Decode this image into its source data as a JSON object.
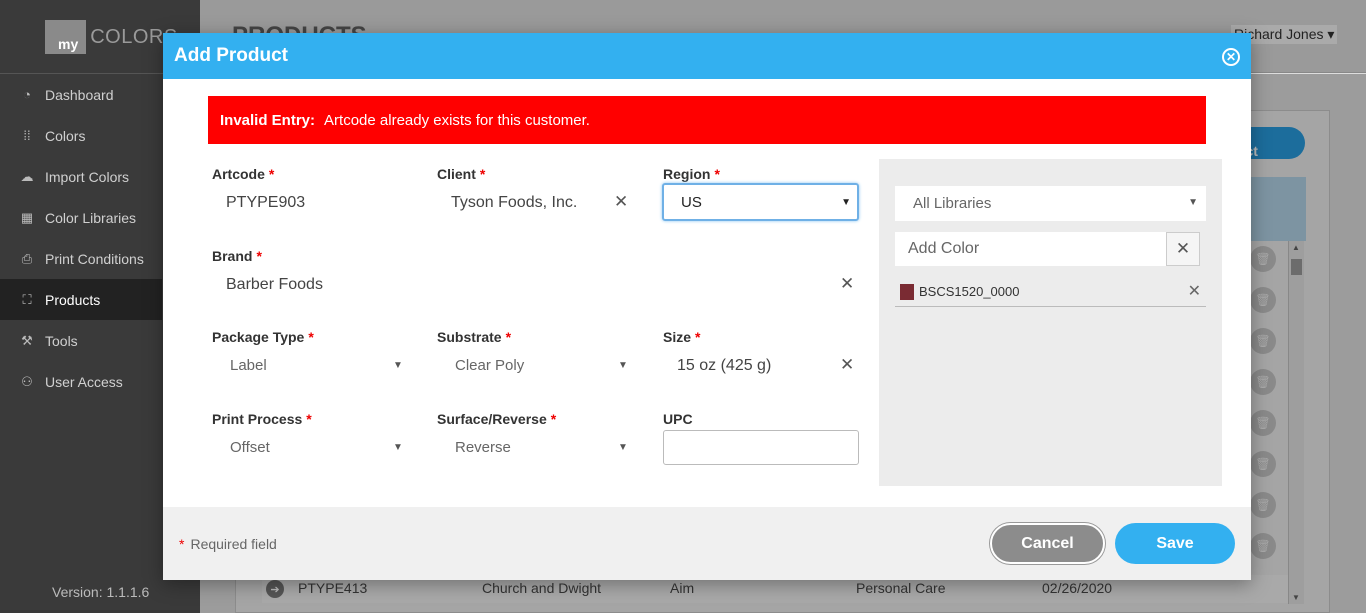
{
  "app": {
    "logo_prefix": "my",
    "logo_word": "COLORS",
    "version": "Version: 1.1.1.6"
  },
  "sidebar": {
    "items": [
      {
        "label": "Dashboard",
        "icon": "dashboard-icon"
      },
      {
        "label": "Colors",
        "icon": "grid-dots-icon"
      },
      {
        "label": "Import Colors",
        "icon": "cloud-download-icon"
      },
      {
        "label": "Color Libraries",
        "icon": "libraries-icon"
      },
      {
        "label": "Print Conditions",
        "icon": "print-icon"
      },
      {
        "label": "Products",
        "icon": "products-icon",
        "active": true
      },
      {
        "label": "Tools",
        "icon": "wrench-icon"
      },
      {
        "label": "User Access",
        "icon": "users-icon"
      }
    ]
  },
  "background": {
    "page_title": "PRODUCTS",
    "user_name": "Richard Jones",
    "add_button_label": "Add Product",
    "row": {
      "artcode": "PTYPE413",
      "client": "Church and Dwight",
      "brand": "Aim",
      "category": "Personal Care",
      "date": "02/26/2020"
    }
  },
  "modal": {
    "title": "Add Product",
    "alert": {
      "prefix": "Invalid Entry:",
      "message": "Artcode already exists for this customer."
    },
    "fields": {
      "artcode": {
        "label": "Artcode",
        "value": "PTYPE903"
      },
      "client": {
        "label": "Client",
        "value": "Tyson Foods, Inc."
      },
      "region": {
        "label": "Region",
        "value": "US"
      },
      "brand": {
        "label": "Brand",
        "value": "Barber Foods"
      },
      "package_type": {
        "label": "Package Type",
        "value": "Label"
      },
      "substrate": {
        "label": "Substrate",
        "value": "Clear Poly"
      },
      "size": {
        "label": "Size",
        "value": "15 oz (425 g)"
      },
      "print_process": {
        "label": "Print Process",
        "value": "Offset"
      },
      "surface_reverse": {
        "label": "Surface/Reverse",
        "value": "Reverse"
      },
      "upc": {
        "label": "UPC",
        "value": ""
      }
    },
    "colors_panel": {
      "library_select": "All Libraries",
      "add_color_placeholder": "Add Color",
      "colors": [
        {
          "name": "BSCS1520_0000",
          "swatch": "#7a2b33"
        }
      ]
    },
    "footer": {
      "required_note": "Required field",
      "cancel_label": "Cancel",
      "save_label": "Save"
    }
  },
  "colors": {
    "header": "#33b0f0",
    "alert": "#ff0000",
    "save": "#33b0f0"
  }
}
